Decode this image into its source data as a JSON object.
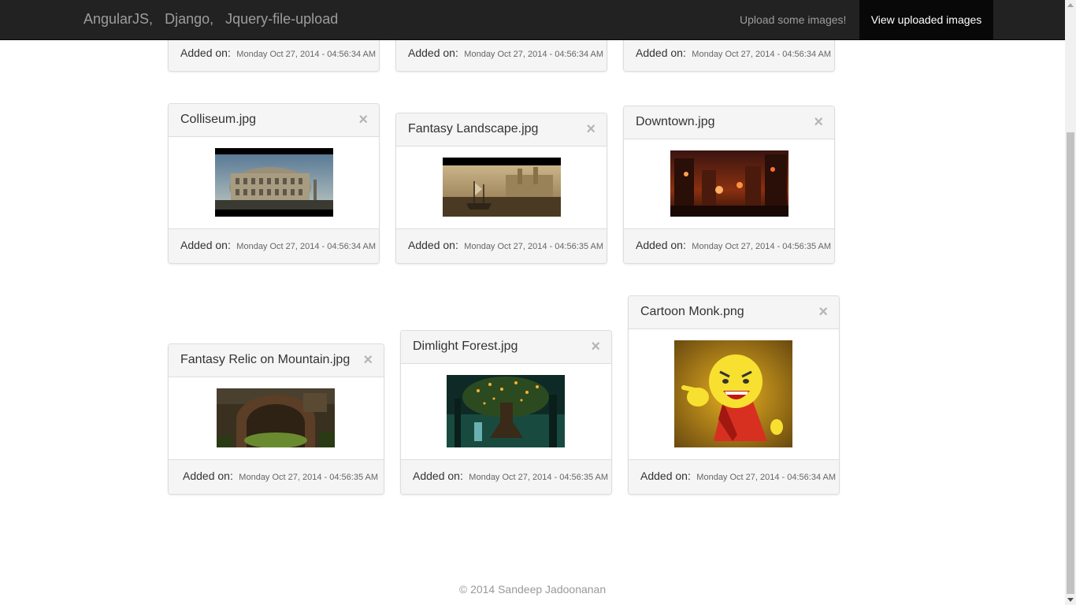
{
  "navbar": {
    "brand_parts": [
      "AngularJS,",
      "Django,",
      "Jquery-file-upload"
    ],
    "upload_link": "Upload some images!",
    "view_link": "View uploaded images"
  },
  "added_label": "Added on:",
  "row0": {
    "dates": [
      "Monday Oct 27, 2014 - 04:56:34 AM",
      "Monday Oct 27, 2014 - 04:56:34 AM",
      "Monday Oct 27, 2014 - 04:56:34 AM"
    ]
  },
  "images": [
    {
      "title": "Colliseum.jpg",
      "date": "Monday Oct 27, 2014 - 04:56:34 AM"
    },
    {
      "title": "Fantasy Landscape.jpg",
      "date": "Monday Oct 27, 2014 - 04:56:35 AM"
    },
    {
      "title": "Downtown.jpg",
      "date": "Monday Oct 27, 2014 - 04:56:35 AM"
    },
    {
      "title": "Fantasy Relic on Mountain.jpg",
      "date": "Monday Oct 27, 2014 - 04:56:35 AM"
    },
    {
      "title": "Dimlight Forest.jpg",
      "date": "Monday Oct 27, 2014 - 04:56:35 AM"
    },
    {
      "title": "Cartoon Monk.png",
      "date": "Monday Oct 27, 2014 - 04:56:34 AM"
    }
  ],
  "close_glyph": "×",
  "footer": {
    "copyright": "© 2014 Sandeep Jadoonanan"
  }
}
